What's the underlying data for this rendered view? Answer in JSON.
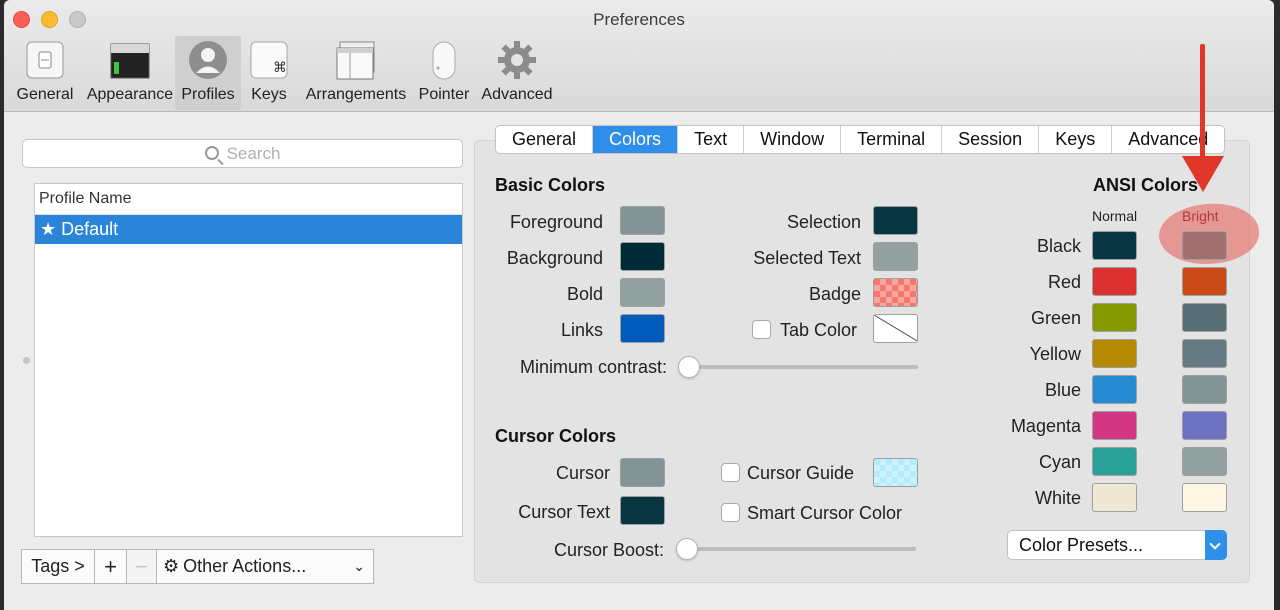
{
  "window": {
    "title": "Preferences"
  },
  "toolbar": [
    {
      "label": "General",
      "icon": "general-switch-icon"
    },
    {
      "label": "Appearance",
      "icon": "appearance-window-icon"
    },
    {
      "label": "Profiles",
      "icon": "profiles-person-icon",
      "selected": true
    },
    {
      "label": "Keys",
      "icon": "command-key-icon"
    },
    {
      "label": "Arrangements",
      "icon": "arrangements-windows-icon"
    },
    {
      "label": "Pointer",
      "icon": "mouse-icon"
    },
    {
      "label": "Advanced",
      "icon": "gear-icon"
    }
  ],
  "search": {
    "placeholder": "Search"
  },
  "profiles": {
    "column_header": "Profile Name",
    "items": [
      {
        "label": "★ Default",
        "selected": true
      }
    ]
  },
  "bottom_bar": {
    "tags": "Tags >",
    "add": "+",
    "remove": "−",
    "other_actions": "Other Actions...",
    "chevron": "⌄"
  },
  "tabs": [
    "General",
    "Colors",
    "Text",
    "Window",
    "Terminal",
    "Session",
    "Keys",
    "Advanced"
  ],
  "active_tab": "Colors",
  "basic_colors": {
    "title": "Basic Colors",
    "foreground": {
      "label": "Foreground",
      "color": "#839496"
    },
    "background": {
      "label": "Background",
      "color": "#002b36"
    },
    "bold": {
      "label": "Bold",
      "color": "#93a1a1"
    },
    "links": {
      "label": "Links",
      "color": "#005bbb"
    },
    "selection": {
      "label": "Selection",
      "color": "#073642"
    },
    "selected_text": {
      "label": "Selected Text",
      "color": "#93a1a1"
    },
    "badge": {
      "label": "Badge",
      "color": "#f3786e"
    },
    "tab_color": {
      "label": "Tab Color",
      "checked": false
    },
    "minimum_contrast": {
      "label": "Minimum contrast:",
      "value": 0
    }
  },
  "cursor_colors": {
    "title": "Cursor Colors",
    "cursor": {
      "label": "Cursor",
      "color": "#839496"
    },
    "cursor_text": {
      "label": "Cursor Text",
      "color": "#073642"
    },
    "cursor_guide": {
      "label": "Cursor Guide",
      "checked": false,
      "color": "#b3ecff"
    },
    "smart_cursor_color": {
      "label": "Smart Cursor Color",
      "checked": false
    },
    "cursor_boost": {
      "label": "Cursor Boost:",
      "value": 0
    }
  },
  "ansi": {
    "title": "ANSI Colors",
    "normal_header": "Normal",
    "bright_header": "Bright",
    "rows": [
      {
        "label": "Black",
        "normal": "#073642",
        "bright": "#a36f71"
      },
      {
        "label": "Red",
        "normal": "#dc322f",
        "bright": "#cb4b16"
      },
      {
        "label": "Green",
        "normal": "#859900",
        "bright": "#586e75"
      },
      {
        "label": "Yellow",
        "normal": "#b58900",
        "bright": "#657b83"
      },
      {
        "label": "Blue",
        "normal": "#268bd2",
        "bright": "#839496"
      },
      {
        "label": "Magenta",
        "normal": "#d33682",
        "bright": "#6c71c4"
      },
      {
        "label": "Cyan",
        "normal": "#2aa198",
        "bright": "#93a1a1"
      },
      {
        "label": "White",
        "normal": "#eee8d5",
        "bright": "#fdf6e3"
      }
    ]
  },
  "color_presets": {
    "label": "Color Presets..."
  },
  "annotation": {
    "color": "#e0372a"
  }
}
